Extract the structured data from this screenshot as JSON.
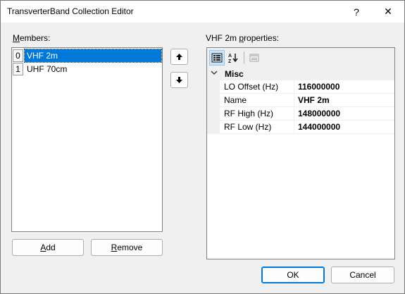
{
  "window": {
    "title": "TransverterBand Collection Editor",
    "help_glyph": "?",
    "close_glyph": "✕"
  },
  "members": {
    "label_accel": "M",
    "label_rest": "embers:",
    "items": [
      {
        "index": "0",
        "text": "VHF 2m",
        "selected": true
      },
      {
        "index": "1",
        "text": "UHF 70cm",
        "selected": false
      }
    ]
  },
  "buttons": {
    "add_accel": "A",
    "add_rest": "dd",
    "remove_accel": "R",
    "remove_rest": "emove",
    "ok": "OK",
    "cancel": "Cancel"
  },
  "properties": {
    "label_pre": "VHF 2m ",
    "label_accel": "p",
    "label_post": "roperties:",
    "category": "Misc",
    "rows": [
      {
        "name": "LO Offset (Hz)",
        "value": "116000000"
      },
      {
        "name": "Name",
        "value": "VHF 2m"
      },
      {
        "name": "RF High (Hz)",
        "value": "148000000"
      },
      {
        "name": "RF Low (Hz)",
        "value": "144000000"
      }
    ]
  },
  "icons": {
    "move_up": "arrow-up-icon",
    "move_down": "arrow-down-icon",
    "categorized": "categorized-icon",
    "alphabetical": "sort-alphabetical-icon",
    "property_pages": "property-pages-icon",
    "collapse": "chevron-down-icon"
  },
  "colors": {
    "selection": "#0078d7",
    "window_bg": "#f0f0f0"
  }
}
